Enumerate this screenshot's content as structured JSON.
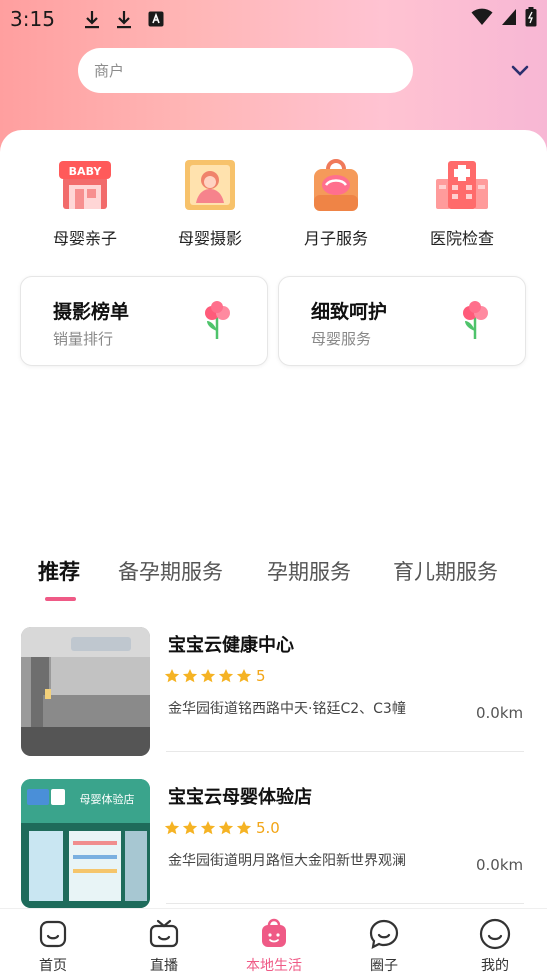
{
  "status_bar": {
    "time": "3:15"
  },
  "search": {
    "placeholder": "商户"
  },
  "categories": [
    {
      "label": "母婴亲子",
      "icon": "baby-store-icon"
    },
    {
      "label": "母婴摄影",
      "icon": "baby-photo-icon"
    },
    {
      "label": "月子服务",
      "icon": "confinement-bag-icon"
    },
    {
      "label": "医院检查",
      "icon": "hospital-icon"
    }
  ],
  "rank_cards": [
    {
      "title": "摄影榜单",
      "subtitle": "销量排行"
    },
    {
      "title": "细致呵护",
      "subtitle": "母婴服务"
    }
  ],
  "tabs": [
    {
      "label": "推荐",
      "active": true
    },
    {
      "label": "备孕期服务",
      "active": false
    },
    {
      "label": "孕期服务",
      "active": false
    },
    {
      "label": "育儿期服务",
      "active": false
    }
  ],
  "shops": [
    {
      "name": "宝宝云健康中心",
      "stars": 5,
      "rating": "5",
      "address": "金华园街道铭西路中天·铭廷C2、C3幢",
      "distance": "0.0km"
    },
    {
      "name": "宝宝云母婴体验店",
      "stars": 5,
      "rating": "5.0",
      "address": "金华园街道明月路恒大金阳新世界观澜",
      "distance": "0.0km"
    }
  ],
  "bottom_nav": [
    {
      "label": "首页",
      "active": false
    },
    {
      "label": "直播",
      "active": false
    },
    {
      "label": "本地生活",
      "active": true
    },
    {
      "label": "圈子",
      "active": false
    },
    {
      "label": "我的",
      "active": false
    }
  ],
  "colors": {
    "accent": "#ef5a86",
    "star": "#f5b324",
    "header_start": "#ff9f9f",
    "header_end": "#f7b7d4"
  }
}
